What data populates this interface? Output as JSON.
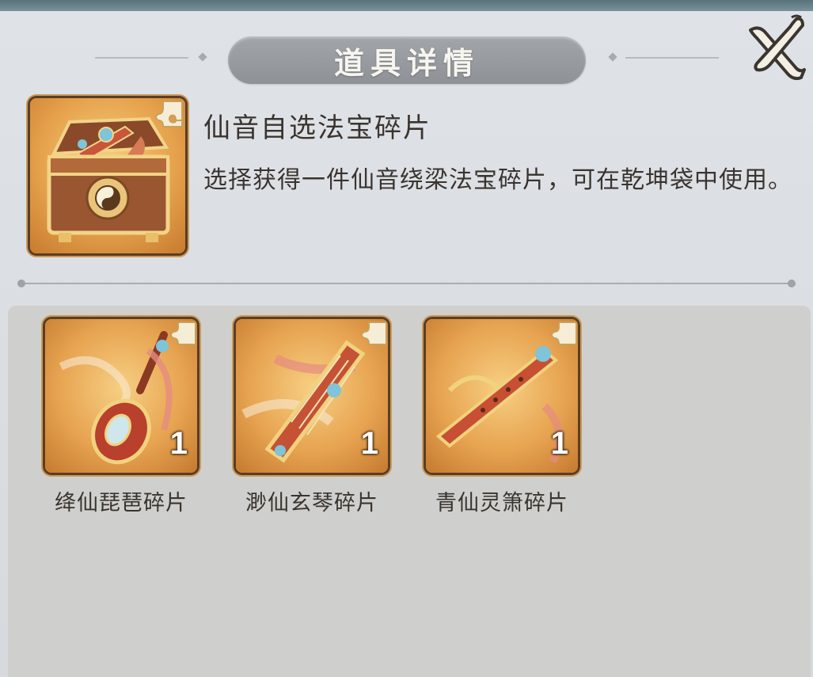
{
  "title": "道具详情",
  "item": {
    "name": "仙音自选法宝碎片",
    "description": "选择获得一件仙音绕梁法宝碎片，可在乾坤袋中使用。"
  },
  "rewards": [
    {
      "name": "绛仙琵琶碎片",
      "quantity": "1",
      "icon": "pipa-icon"
    },
    {
      "name": "渺仙玄琴碎片",
      "quantity": "1",
      "icon": "guqin-icon"
    },
    {
      "name": "青仙灵箫碎片",
      "quantity": "1",
      "icon": "flute-icon"
    }
  ],
  "colors": {
    "panel_bg": "#d9dde1",
    "title_bar": "#979ba0",
    "item_frame": "#e6a24d",
    "reward_area": "#cfd0cd"
  },
  "icons": {
    "close": "close-icon",
    "item": "treasure-chest-icon"
  }
}
